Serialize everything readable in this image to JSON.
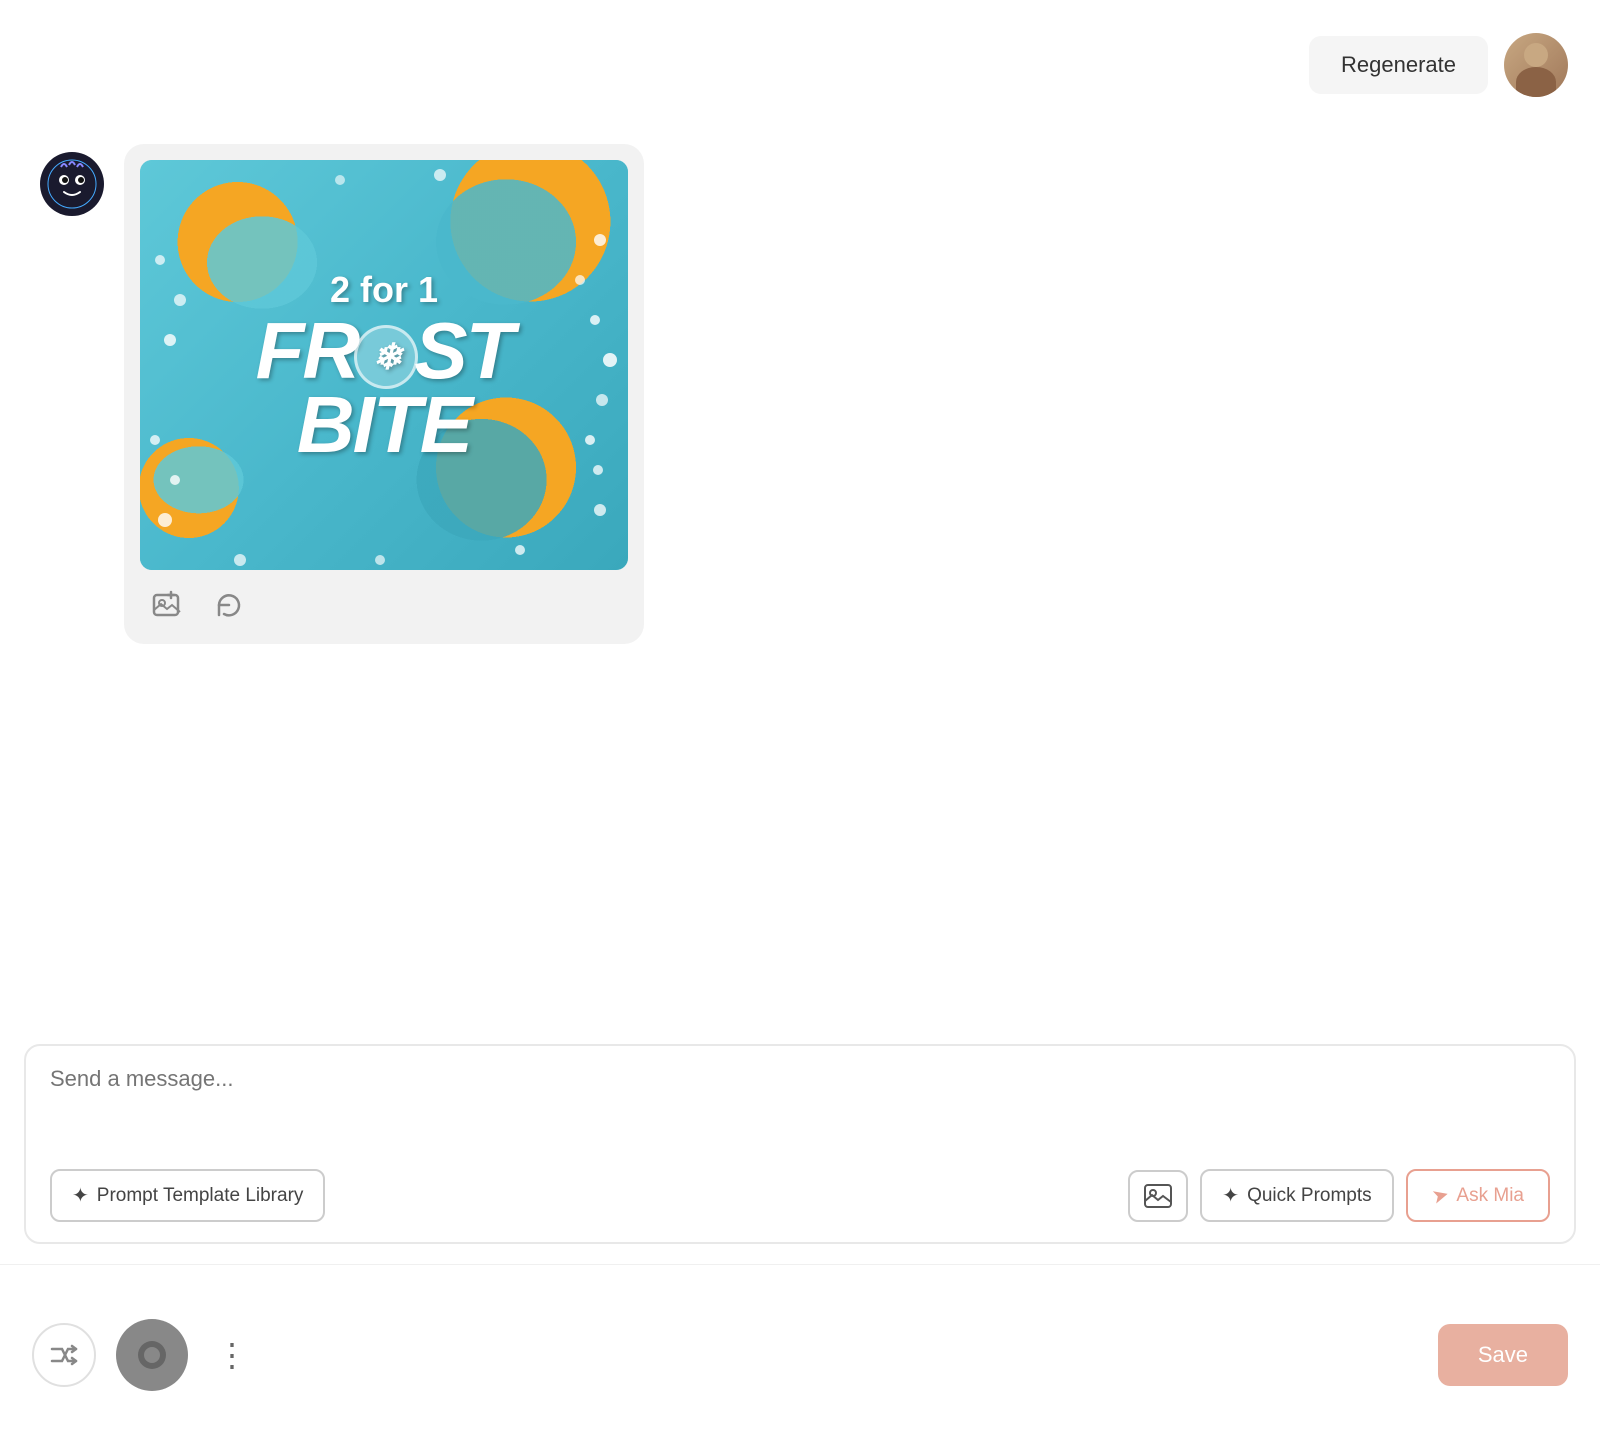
{
  "top_bar": {
    "regenerate_label": "Regenerate"
  },
  "ai_message": {
    "image_alt": "2 for 1 Frost Bite donut promotional image",
    "text_line1": "2 for 1",
    "text_frost": "FR",
    "text_snowflake": "❄",
    "text_st": "ST",
    "text_bite": "BITE"
  },
  "image_icons": {
    "add_photo_label": "add photo",
    "refresh_label": "refresh"
  },
  "input_area": {
    "placeholder": "Send a message...",
    "prompt_library_label": "Prompt Template Library",
    "quick_prompts_label": "Quick Prompts",
    "ask_mia_label": "Ask Mia",
    "wand_icon": "✦",
    "image_icon": "⊞",
    "send_icon": "➤"
  },
  "bottom_toolbar": {
    "shuffle_icon": "⇄",
    "record_icon": "●",
    "more_icon": "⋮",
    "save_label": "Save"
  }
}
